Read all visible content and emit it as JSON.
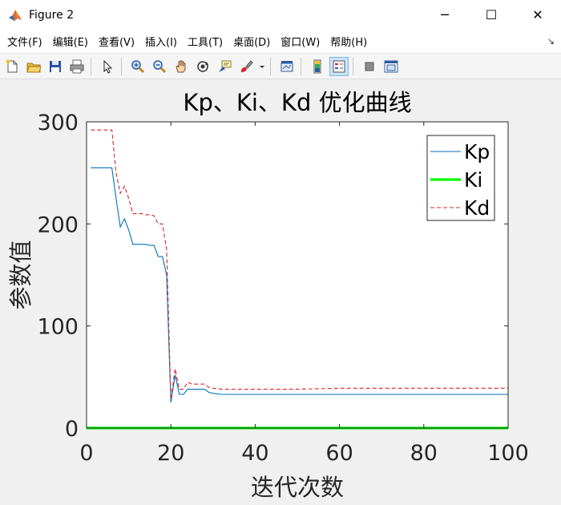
{
  "window": {
    "title": "Figure 2",
    "minimize_glyph": "─",
    "maximize_glyph": "☐",
    "close_glyph": "✕"
  },
  "menu": {
    "items": [
      "文件(F)",
      "编辑(E)",
      "查看(V)",
      "插入(I)",
      "工具(T)",
      "桌面(D)",
      "窗口(W)",
      "帮助(H)"
    ],
    "corner_glyph": "↘"
  },
  "toolbar": {
    "icons": [
      "new-figure-icon",
      "open-file-icon",
      "save-icon",
      "print-icon",
      "pointer-icon",
      "zoom-in-icon",
      "zoom-out-icon",
      "pan-hand-icon",
      "rotate-3d-icon",
      "data-cursor-icon",
      "brush-icon",
      "link-plot-icon",
      "colorbar-icon",
      "legend-icon",
      "hide-plot-tools-icon",
      "show-plot-tools-icon"
    ]
  },
  "colors": {
    "kp": "#0072bd",
    "ki": "#00ff00",
    "kd": "#d62728",
    "axes_bg": "#ffffff",
    "figure_bg": "#f0f0f0"
  },
  "chart_data": {
    "type": "line",
    "title": "Kp、Ki、Kd 优化曲线",
    "xlabel": "迭代次数",
    "ylabel": "参数值",
    "xlim": [
      0,
      100
    ],
    "ylim": [
      0,
      300
    ],
    "xticks": [
      0,
      20,
      40,
      60,
      80,
      100
    ],
    "yticks": [
      0,
      100,
      200,
      300
    ],
    "grid": false,
    "legend_position": "top-right",
    "series": [
      {
        "name": "Kp",
        "style": "solid",
        "x": [
          1,
          2,
          3,
          4,
          5,
          6,
          7,
          8,
          9,
          10,
          11,
          12,
          13,
          14,
          15,
          16,
          17,
          18,
          19,
          20,
          21,
          22,
          23,
          24,
          25,
          26,
          27,
          28,
          29,
          30,
          32,
          35,
          40,
          45,
          50,
          60,
          70,
          80,
          90,
          100
        ],
        "y": [
          255,
          255,
          255,
          255,
          255,
          255,
          225,
          197,
          205,
          194,
          180,
          180,
          180,
          180,
          179,
          179,
          168,
          168,
          150,
          25,
          52,
          33,
          33,
          38,
          38,
          38,
          38,
          38,
          35,
          34,
          33,
          33,
          33,
          33,
          33,
          33,
          33,
          33,
          33,
          33
        ]
      },
      {
        "name": "Ki",
        "style": "solid",
        "x": [
          0,
          100
        ],
        "y": [
          0,
          0
        ]
      },
      {
        "name": "Kd",
        "style": "dashed",
        "x": [
          1,
          2,
          3,
          4,
          5,
          6,
          7,
          8,
          9,
          10,
          11,
          12,
          13,
          14,
          15,
          16,
          17,
          18,
          19,
          20,
          21,
          22,
          23,
          24,
          25,
          26,
          27,
          28,
          29,
          30,
          32,
          35,
          40,
          45,
          50,
          60,
          70,
          80,
          90,
          100
        ],
        "y": [
          292,
          292,
          292,
          292,
          292,
          292,
          250,
          230,
          237,
          225,
          210,
          210,
          210,
          209,
          209,
          208,
          200,
          200,
          175,
          28,
          58,
          38,
          38,
          45,
          43,
          43,
          43,
          43,
          40,
          39,
          38,
          38,
          38,
          38,
          38,
          39,
          39,
          39,
          39,
          39
        ]
      }
    ]
  }
}
